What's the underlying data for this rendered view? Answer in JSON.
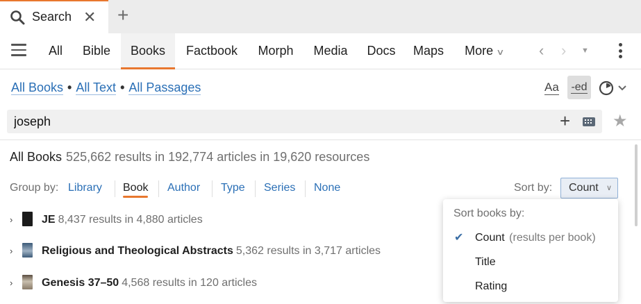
{
  "tab": {
    "label": "Search",
    "close": "✕",
    "new_tab": "+"
  },
  "nav": {
    "items": [
      "All",
      "Bible",
      "Books",
      "Factbook",
      "Morph",
      "Media",
      "Docs",
      "Maps",
      "More"
    ],
    "active": "Books"
  },
  "scope": {
    "books": "All Books",
    "text": "All Text",
    "passages": "All Passages"
  },
  "toolbar_icons": {
    "font": "Aa",
    "inflection": "-ed"
  },
  "search": {
    "query": "joseph",
    "plus": "+",
    "star": "★"
  },
  "summary": {
    "title": "All Books",
    "stats": "525,662 results in 192,774 articles in 19,620 resources"
  },
  "groupby": {
    "label": "Group by:",
    "options": [
      "Library",
      "Book",
      "Author",
      "Type",
      "Series",
      "None"
    ],
    "active": "Book"
  },
  "sortby": {
    "label": "Sort by:",
    "value": "Count"
  },
  "results": [
    {
      "title": "JE",
      "meta": "8,437 results in 4,880 articles",
      "cover_color": "#1b1b1b"
    },
    {
      "title": "Religious and Theological Abstracts",
      "meta": "5,362 results in 3,717 articles",
      "cover_color": "#3c5a78"
    },
    {
      "title": "Genesis 37–50",
      "meta": "4,568 results in 120 articles",
      "cover_color": "#8a7b69"
    }
  ],
  "sort_menu": {
    "header": "Sort books by:",
    "items": [
      {
        "label": "Count",
        "note": "(results per book)",
        "checked": true
      },
      {
        "label": "Title",
        "note": "",
        "checked": false
      },
      {
        "label": "Rating",
        "note": "",
        "checked": false
      }
    ]
  },
  "colors": {
    "accent": "#e8772e",
    "link": "#2a6fb6"
  }
}
